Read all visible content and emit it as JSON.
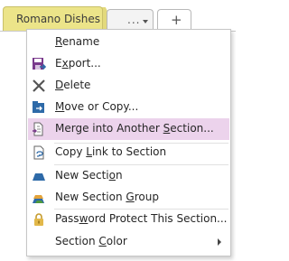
{
  "tabs": {
    "section_name": "Romano Dishes",
    "more_label": "...",
    "add_label": "+"
  },
  "menu": {
    "items": [
      {
        "pre": "",
        "ul": "R",
        "post": "ename",
        "icon": "none"
      },
      {
        "pre": "E",
        "ul": "x",
        "post": "port...",
        "icon": "export-icon"
      },
      {
        "pre": "",
        "ul": "D",
        "post": "elete",
        "icon": "delete-x-icon"
      },
      {
        "pre": "",
        "ul": "M",
        "post": "ove or Copy...",
        "icon": "move-copy-icon"
      },
      {
        "pre": "Merge into Another ",
        "ul": "S",
        "post": "ection...",
        "icon": "merge-icon"
      },
      {
        "pre": "Copy ",
        "ul": "L",
        "post": "ink to Section",
        "icon": "copy-link-icon"
      },
      {
        "pre": "New Secti",
        "ul": "o",
        "post": "n",
        "icon": "new-section-icon"
      },
      {
        "pre": "New Section ",
        "ul": "G",
        "post": "roup",
        "icon": "new-section-group-icon"
      },
      {
        "pre": "Pass",
        "ul": "w",
        "post": "ord Protect This Section...",
        "icon": "lock-icon"
      },
      {
        "pre": "Section ",
        "ul": "C",
        "post": "olor",
        "icon": "none"
      }
    ],
    "highlighted_item": "Merge into Another Section..."
  },
  "colors": {
    "tab_yellow": "#ece489",
    "highlight": "#ecd3ec",
    "icon_purple": "#7a3a8c",
    "icon_blue": "#2e6aa8"
  }
}
